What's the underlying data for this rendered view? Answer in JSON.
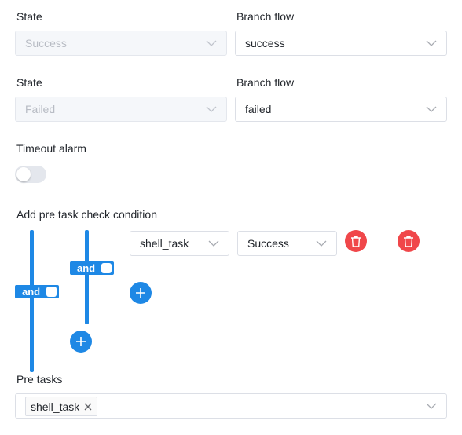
{
  "success_row": {
    "state_label": "State",
    "branch_label": "Branch flow",
    "state_value": "Success",
    "branch_value": "success"
  },
  "failed_row": {
    "state_label": "State",
    "branch_label": "Branch flow",
    "state_value": "Failed",
    "branch_value": "failed"
  },
  "timeout": {
    "label": "Timeout alarm",
    "enabled": false
  },
  "pre_check": {
    "label": "Add pre task check condition",
    "outer_relation": "and",
    "inner_relation": "and",
    "condition": {
      "task": "shell_task",
      "status": "Success"
    }
  },
  "pre_tasks": {
    "label": "Pre tasks",
    "tags": [
      "shell_task"
    ]
  },
  "colors": {
    "accent": "#1e88e5",
    "danger": "#f0474a"
  },
  "icons": [
    "chevron-down-icon",
    "plus-icon",
    "trash-icon",
    "close-icon"
  ]
}
